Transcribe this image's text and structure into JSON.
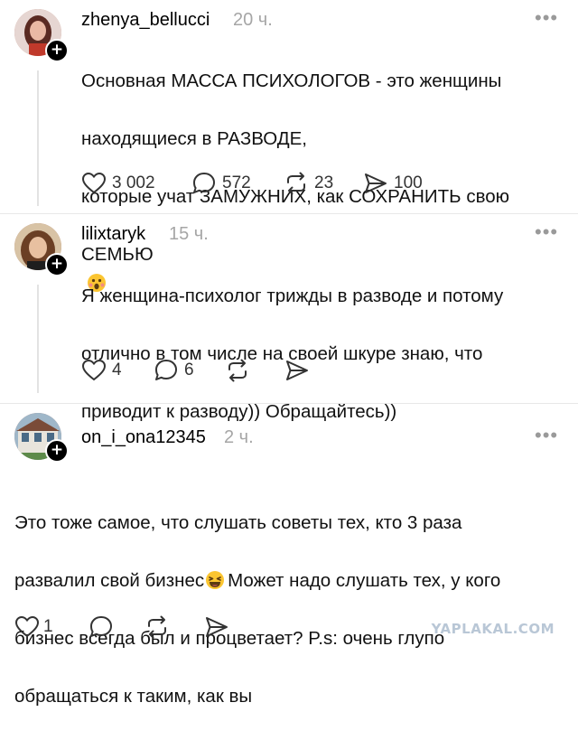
{
  "posts": [
    {
      "username": "zhenya_bellucci",
      "time": "20 ч.",
      "text_lines": [
        "Основная МАССА ПСИХОЛОГОВ - это женщины",
        "находящиеся в РАЗВОДЕ,",
        "которые учат ЗАМУЖНИХ, как СОХРАНИТЬ свою",
        "СЕМЬЮ"
      ],
      "emoji": "surprised-face",
      "likes": "3 002",
      "comments": "572",
      "reposts": "23",
      "shares": "100"
    },
    {
      "username": "lilixtaryk",
      "time": "15 ч.",
      "text_lines": [
        "Я женщина-психолог трижды в разводе и потому",
        "отлично в том числе на своей шкуре знаю, что",
        "приводит к разводу)) Обращайтесь))"
      ],
      "likes": "4",
      "comments": "6"
    },
    {
      "username": "on_i_ona12345",
      "time": "2 ч.",
      "text_lines": [
        "Это тоже самое, что слушать советы тех, кто 3 раза",
        "развалил свой бизнес",
        "Может надо слушать тех, у кого",
        "бизнес всегда был и процветает? P.s: очень глупо",
        "обращаться к таким, как вы"
      ],
      "emoji": "laughing-face",
      "likes": "1"
    }
  ],
  "more_label": "•••",
  "plus_label": "+",
  "watermark": "YAPLAKAL.COM"
}
